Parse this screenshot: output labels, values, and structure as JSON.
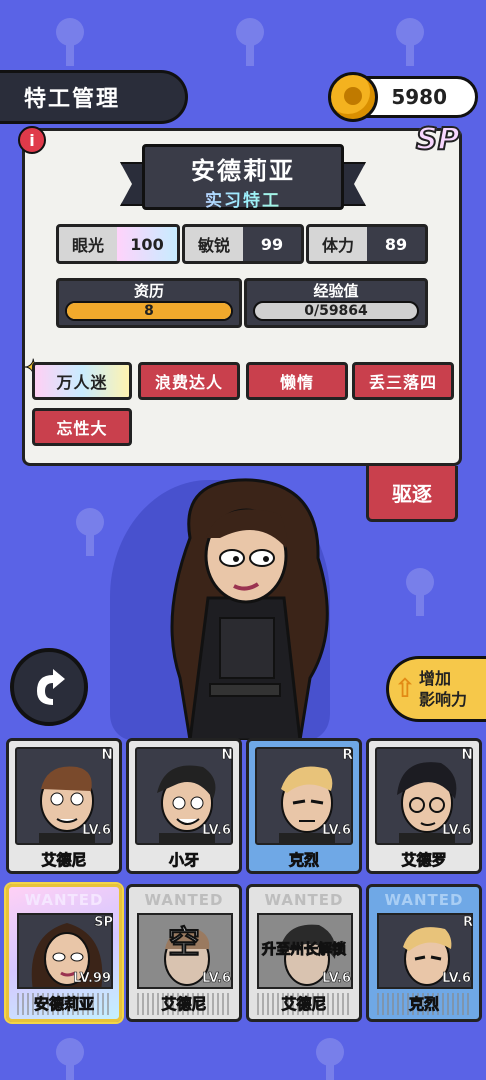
{
  "header": {
    "title": "特工管理",
    "coins": "5980"
  },
  "card": {
    "info_icon": "i",
    "rarity_badge": "SP",
    "agent_name": "安德莉亚",
    "agent_rank": "实习特工",
    "stats": [
      {
        "label": "眼光",
        "value": "100"
      },
      {
        "label": "敏锐",
        "value": "99"
      },
      {
        "label": "体力",
        "value": "89"
      }
    ],
    "resume": {
      "label": "资历",
      "value": "8",
      "fill": 1.0
    },
    "experience": {
      "label": "经验值",
      "value": "0/59864",
      "fill": 0.0
    },
    "traits": [
      "万人迷",
      "浪费达人",
      "懒惰",
      "丢三落四",
      "忘性大"
    ]
  },
  "expel_label": "驱逐",
  "influence_label_1": "增加",
  "influence_label_2": "影响力",
  "agents": [
    {
      "name": "艾德尼",
      "level": "LV.6",
      "rarity": "N"
    },
    {
      "name": "小牙",
      "level": "LV.6",
      "rarity": "N"
    },
    {
      "name": "克烈",
      "level": "LV.6",
      "rarity": "R"
    },
    {
      "name": "艾德罗",
      "level": "LV.6",
      "rarity": "N"
    }
  ],
  "wanted": [
    {
      "tag": "WANTED",
      "name": "安德莉亚",
      "level": "LV.99",
      "rarity": "SP",
      "overlay": ""
    },
    {
      "tag": "WANTED",
      "name": "艾德尼",
      "level": "LV.6",
      "rarity": "",
      "overlay": "空"
    },
    {
      "tag": "WANTED",
      "name": "艾德尼",
      "level": "LV.6",
      "rarity": "",
      "overlay": "升至州长解锁"
    },
    {
      "tag": "WANTED",
      "name": "克烈",
      "level": "LV.6",
      "rarity": "R",
      "overlay": ""
    }
  ],
  "colors": {
    "background": "#5a63e6",
    "trait_red": "#c9404d",
    "gold": "#f1a92c",
    "rare_blue": "#6fa8e6"
  }
}
